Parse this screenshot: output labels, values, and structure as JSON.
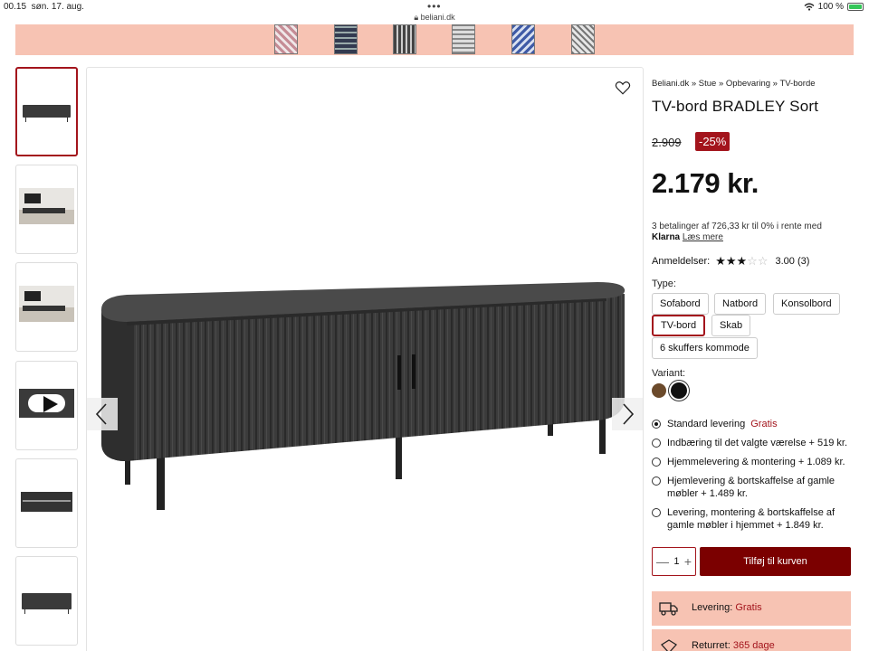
{
  "status_bar": {
    "time": "00.15",
    "date": "søn. 17. aug.",
    "url": "beliani.dk",
    "battery": "100 %"
  },
  "breadcrumb": {
    "items": [
      "Beliani.dk",
      "Stue",
      "Opbevaring",
      "TV-borde"
    ],
    "separator": "»"
  },
  "product": {
    "title": "TV-bord BRADLEY Sort",
    "old_price": "2.909",
    "discount": "-25%",
    "price": "2.179 kr.",
    "klarna_text": "3 betalinger af 726,33 kr til 0% i rente med",
    "klarna_logo": "Klarna",
    "klarna_link": "Læs mere"
  },
  "reviews": {
    "label": "Anmeldelser:",
    "rating": 3.0,
    "max": 5,
    "score_text": "3.00 (3)"
  },
  "type": {
    "label": "Type:",
    "options": [
      "Sofabord",
      "Natbord",
      "Konsolbord",
      "TV-bord",
      "Skab",
      "6 skuffers kommode"
    ],
    "selected": "TV-bord"
  },
  "variant": {
    "label": "Variant:",
    "colors": [
      "#6b4a2b",
      "#111111"
    ],
    "selected_index": 1
  },
  "delivery": {
    "options": [
      {
        "text": "Standard levering",
        "extra": "Gratis",
        "selected": true
      },
      {
        "text": "Indbæring til det valgte værelse + 519 kr.",
        "extra": "",
        "selected": false
      },
      {
        "text": "Hjemmelevering & montering + 1.089 kr.",
        "extra": "",
        "selected": false
      },
      {
        "text": "Hjemlevering & bortskaffelse af gamle møbler + 1.489 kr.",
        "extra": "",
        "selected": false
      },
      {
        "text": "Levering, montering & bortskaffelse af gamle møbler i hjemmet + 1.849 kr.",
        "extra": "",
        "selected": false
      }
    ]
  },
  "cart": {
    "quantity": "1",
    "minus": "—",
    "plus": "+",
    "add_label": "Tilføj til kurven"
  },
  "info": {
    "delivery_label": "Levering:",
    "delivery_value": "Gratis",
    "returns_label": "Returret:",
    "returns_value": "365 dage"
  },
  "colors": {
    "accent": "#a3141c",
    "dark_red": "#7b0000",
    "banner": "#f7c3b3"
  }
}
